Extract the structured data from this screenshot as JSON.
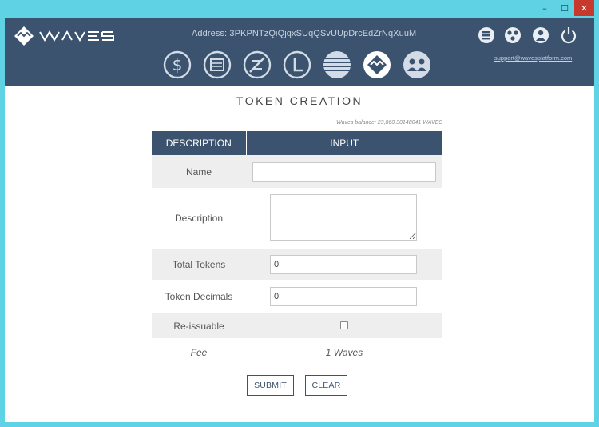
{
  "window": {
    "controls": {
      "minimize": "–",
      "maximize": "☐",
      "close": "✕"
    }
  },
  "header": {
    "logo_text": "WAVES",
    "address_label": "Address:",
    "address_value": "3PKPNTzQiQjqxSUqQSvUUpDrcEdZrNqXuuM",
    "top_icons": [
      "server-icon",
      "network-icon",
      "user-icon",
      "power-icon"
    ],
    "support_email": "support@wavesplatform.com",
    "nav_icons": [
      "wallet-icon",
      "documents-icon",
      "no-exchange-icon",
      "ledger-icon",
      "explorer-icon",
      "token-icon",
      "community-icon"
    ],
    "active_nav": "token-icon",
    "colors": {
      "bar": "#3b536e",
      "frame": "#5fd2e4",
      "close": "#c7392c"
    }
  },
  "main": {
    "title": "TOKEN CREATION",
    "balance": "Waves balance: 23,860.30148041 WAVES",
    "table": {
      "headers": [
        "DESCRIPTION",
        "INPUT"
      ],
      "rows": {
        "name": {
          "label": "Name",
          "value": ""
        },
        "description": {
          "label": "Description",
          "value": ""
        },
        "total_tokens": {
          "label": "Total Tokens",
          "value": "0"
        },
        "token_decimals": {
          "label": "Token Decimals",
          "value": "0"
        },
        "reissuable": {
          "label": "Re-issuable",
          "checked": false
        },
        "fee": {
          "label": "Fee",
          "value": "1 Waves"
        }
      }
    },
    "buttons": {
      "submit": "SUBMIT",
      "clear": "CLEAR"
    }
  }
}
